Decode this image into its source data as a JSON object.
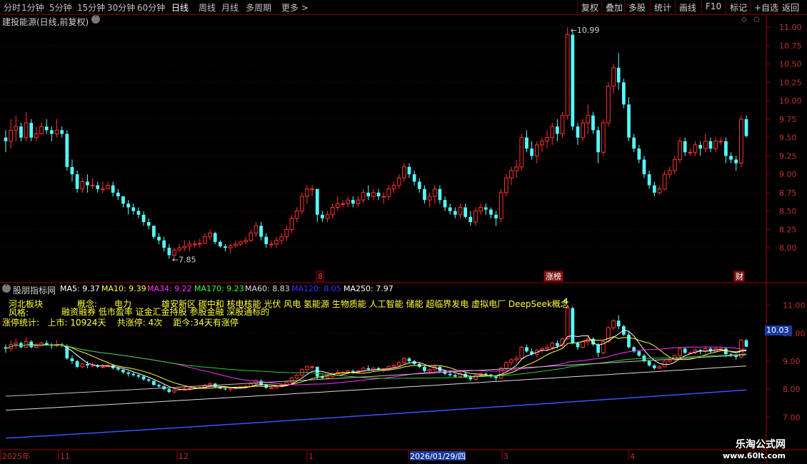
{
  "toolbar": {
    "timeframes": [
      "分时",
      "1分钟",
      "5分钟",
      "15分钟",
      "30分钟",
      "60分钟",
      "日线",
      "周线",
      "月线",
      "多周期",
      "更多 >"
    ],
    "active_timeframe": "日线",
    "buttons": [
      "复权",
      "叠加",
      "多股",
      "统计",
      "画线",
      "F10",
      "标记",
      "+自选",
      "返回"
    ]
  },
  "main_panel": {
    "title": "建投能源(日线,前复权)",
    "high_label": "10.99",
    "low_label": "7.85",
    "event_markers": [
      "8",
      "涨榜",
      "财"
    ]
  },
  "indicator_panel": {
    "title": "股朋指标网",
    "ma_items": [
      {
        "label": "MA5: 9.37",
        "color": "#ffffff"
      },
      {
        "label": "MA10: 9.39",
        "color": "#ffff33"
      },
      {
        "label": "MA34: 9.22",
        "color": "#ff33ff"
      },
      {
        "label": "MA170: 9.23",
        "color": "#33ff33"
      },
      {
        "label": "MA60: 8.83",
        "color": "#dddddd"
      },
      {
        "label": "MA120: 8.05",
        "color": "#3333ff"
      },
      {
        "label": "MA250: 7.97",
        "color": "#ffffff"
      }
    ],
    "sector_label": "河北板块",
    "concept_label": "概念:",
    "concepts": "电力           雄安新区 碳中和 核电核能 光伏 风电 氢能源 生物质能 人工智能 储能 超临界发电 虚拟电厂 DeepSeek概念",
    "style_label": "风格:",
    "styles": "融资融券 低市盈率 证金汇金持股 参股金融 深股通标的",
    "limit_stats": "涨停统计:   上市: 10924天    共涨停: 4次    距今:34天有涨停",
    "current_value": "10.03",
    "top_mark": "4"
  },
  "x_axis": {
    "labels": [
      "2025年",
      "11",
      "12",
      "1",
      "2026/01/29/四",
      "3",
      "4"
    ]
  },
  "watermark": {
    "name": "乐淘公式网",
    "url": "www.60lt.com"
  },
  "chart_data": {
    "type": "candlestick",
    "title": "建投能源(日线,前复权)",
    "main_y_ticks": [
      11.0,
      10.75,
      10.5,
      10.25,
      10.0,
      9.75,
      9.5,
      9.25,
      9.0,
      8.75,
      8.5,
      8.25,
      8.0
    ],
    "main_ylim": [
      7.7,
      11.08
    ],
    "sub_y_ticks": [
      11.0,
      10.0,
      9.0,
      8.0,
      7.0
    ],
    "sub_ylim": [
      6.6,
      11.4
    ],
    "candles": [
      [
        9.5,
        9.6,
        9.3,
        9.45
      ],
      [
        9.45,
        9.75,
        9.35,
        9.6
      ],
      [
        9.6,
        9.8,
        9.45,
        9.65
      ],
      [
        9.65,
        9.7,
        9.45,
        9.5
      ],
      [
        9.5,
        9.85,
        9.45,
        9.7
      ],
      [
        9.7,
        9.75,
        9.45,
        9.5
      ],
      [
        9.5,
        9.65,
        9.45,
        9.55
      ],
      [
        9.55,
        9.7,
        9.55,
        9.65
      ],
      [
        9.65,
        9.75,
        9.55,
        9.6
      ],
      [
        9.6,
        9.65,
        9.45,
        9.55
      ],
      [
        9.55,
        9.75,
        9.5,
        9.6
      ],
      [
        9.6,
        9.65,
        9.5,
        9.55
      ],
      [
        9.55,
        9.6,
        9.05,
        9.1
      ],
      [
        9.1,
        9.2,
        8.9,
        9.0
      ],
      [
        9.0,
        9.05,
        8.75,
        8.8
      ],
      [
        8.8,
        8.95,
        8.75,
        8.9
      ],
      [
        8.9,
        9.0,
        8.75,
        8.85
      ],
      [
        8.85,
        8.95,
        8.8,
        8.85
      ],
      [
        8.85,
        8.9,
        8.75,
        8.8
      ],
      [
        8.8,
        8.9,
        8.75,
        8.8
      ],
      [
        8.8,
        8.9,
        8.8,
        8.85
      ],
      [
        8.85,
        8.9,
        8.7,
        8.75
      ],
      [
        8.75,
        8.8,
        8.65,
        8.7
      ],
      [
        8.7,
        8.7,
        8.55,
        8.6
      ],
      [
        8.6,
        8.65,
        8.45,
        8.55
      ],
      [
        8.55,
        8.6,
        8.45,
        8.5
      ],
      [
        8.5,
        8.55,
        8.4,
        8.45
      ],
      [
        8.45,
        8.5,
        8.3,
        8.35
      ],
      [
        8.35,
        8.4,
        8.25,
        8.3
      ],
      [
        8.3,
        8.3,
        8.12,
        8.15
      ],
      [
        8.15,
        8.2,
        8.05,
        8.1
      ],
      [
        8.1,
        8.15,
        7.95,
        8.0
      ],
      [
        8.0,
        8.05,
        7.85,
        7.9
      ],
      [
        7.9,
        8.0,
        7.85,
        7.97
      ],
      [
        7.97,
        8.05,
        7.95,
        8.0
      ],
      [
        8.0,
        8.1,
        7.95,
        8.02
      ],
      [
        8.02,
        8.1,
        7.95,
        8.05
      ],
      [
        8.05,
        8.1,
        8.0,
        8.05
      ],
      [
        8.05,
        8.12,
        8.0,
        8.06
      ],
      [
        8.06,
        8.2,
        8.05,
        8.15
      ],
      [
        8.15,
        8.25,
        8.1,
        8.2
      ],
      [
        8.2,
        8.22,
        8.05,
        8.08
      ],
      [
        8.08,
        8.1,
        8.0,
        8.02
      ],
      [
        8.02,
        8.05,
        7.95,
        8.0
      ],
      [
        8.0,
        8.05,
        7.92,
        8.03
      ],
      [
        8.03,
        8.1,
        8.0,
        8.05
      ],
      [
        8.05,
        8.1,
        8.02,
        8.08
      ],
      [
        8.08,
        8.15,
        8.05,
        8.1
      ],
      [
        8.1,
        8.25,
        8.08,
        8.2
      ],
      [
        8.2,
        8.35,
        8.15,
        8.3
      ],
      [
        8.3,
        8.35,
        8.1,
        8.15
      ],
      [
        8.15,
        8.2,
        8.0,
        8.05
      ],
      [
        8.05,
        8.1,
        8.0,
        8.05
      ],
      [
        8.05,
        8.15,
        8.0,
        8.1
      ],
      [
        8.1,
        8.2,
        8.05,
        8.15
      ],
      [
        8.15,
        8.3,
        8.1,
        8.25
      ],
      [
        8.25,
        8.45,
        8.2,
        8.4
      ],
      [
        8.4,
        8.55,
        8.35,
        8.5
      ],
      [
        8.5,
        8.75,
        8.45,
        8.7
      ],
      [
        8.7,
        8.85,
        8.6,
        8.8
      ],
      [
        8.8,
        8.85,
        8.7,
        8.8
      ],
      [
        8.8,
        8.8,
        8.35,
        8.45
      ],
      [
        8.45,
        8.5,
        8.35,
        8.4
      ],
      [
        8.4,
        8.5,
        8.35,
        8.45
      ],
      [
        8.45,
        8.6,
        8.4,
        8.55
      ],
      [
        8.55,
        8.7,
        8.5,
        8.6
      ],
      [
        8.6,
        8.65,
        8.55,
        8.6
      ],
      [
        8.6,
        8.7,
        8.55,
        8.65
      ],
      [
        8.65,
        8.7,
        8.55,
        8.6
      ],
      [
        8.6,
        8.7,
        8.55,
        8.65
      ],
      [
        8.65,
        8.8,
        8.6,
        8.75
      ],
      [
        8.75,
        8.85,
        8.65,
        8.7
      ],
      [
        8.7,
        8.8,
        8.65,
        8.75
      ],
      [
        8.75,
        8.8,
        8.65,
        8.7
      ],
      [
        8.7,
        8.75,
        8.6,
        8.7
      ],
      [
        8.7,
        8.85,
        8.65,
        8.8
      ],
      [
        8.8,
        8.9,
        8.75,
        8.85
      ],
      [
        8.85,
        9.0,
        8.8,
        8.95
      ],
      [
        8.95,
        9.15,
        8.9,
        9.1
      ],
      [
        9.1,
        9.15,
        8.95,
        9.0
      ],
      [
        9.0,
        9.05,
        8.85,
        8.9
      ],
      [
        8.9,
        8.95,
        8.75,
        8.8
      ],
      [
        8.8,
        8.85,
        8.6,
        8.65
      ],
      [
        8.65,
        8.75,
        8.55,
        8.7
      ],
      [
        8.7,
        8.85,
        8.6,
        8.8
      ],
      [
        8.8,
        8.85,
        8.6,
        8.65
      ],
      [
        8.65,
        8.7,
        8.5,
        8.55
      ],
      [
        8.55,
        8.6,
        8.45,
        8.5
      ],
      [
        8.5,
        8.55,
        8.4,
        8.45
      ],
      [
        8.45,
        8.6,
        8.4,
        8.55
      ],
      [
        8.55,
        8.6,
        8.4,
        8.42
      ],
      [
        8.42,
        8.5,
        8.3,
        8.35
      ],
      [
        8.35,
        8.55,
        8.3,
        8.5
      ],
      [
        8.5,
        8.6,
        8.45,
        8.55
      ],
      [
        8.55,
        8.6,
        8.45,
        8.52
      ],
      [
        8.52,
        8.55,
        8.4,
        8.45
      ],
      [
        8.45,
        8.5,
        8.3,
        8.4
      ],
      [
        8.4,
        8.8,
        8.35,
        8.75
      ],
      [
        8.75,
        9.0,
        8.7,
        8.95
      ],
      [
        8.95,
        9.1,
        8.85,
        9.05
      ],
      [
        9.05,
        9.2,
        8.95,
        9.1
      ],
      [
        9.1,
        9.55,
        9.05,
        9.5
      ],
      [
        9.5,
        9.6,
        9.3,
        9.35
      ],
      [
        9.35,
        9.45,
        9.2,
        9.25
      ],
      [
        9.25,
        9.45,
        9.15,
        9.4
      ],
      [
        9.4,
        9.5,
        9.3,
        9.45
      ],
      [
        9.45,
        9.6,
        9.35,
        9.5
      ],
      [
        9.5,
        9.7,
        9.4,
        9.65
      ],
      [
        9.65,
        9.75,
        9.45,
        9.55
      ],
      [
        9.55,
        9.85,
        9.5,
        9.8
      ],
      [
        9.8,
        11.0,
        9.75,
        10.9
      ],
      [
        10.9,
        10.95,
        9.6,
        9.65
      ],
      [
        9.65,
        9.7,
        9.4,
        9.5
      ],
      [
        9.5,
        9.75,
        9.45,
        9.7
      ],
      [
        9.7,
        9.95,
        9.55,
        9.8
      ],
      [
        9.8,
        9.85,
        9.55,
        9.6
      ],
      [
        9.6,
        9.65,
        9.15,
        9.3
      ],
      [
        9.3,
        9.75,
        9.25,
        9.7
      ],
      [
        9.7,
        10.25,
        9.65,
        10.2
      ],
      [
        10.2,
        10.5,
        10.1,
        10.45
      ],
      [
        10.45,
        10.65,
        10.15,
        10.25
      ],
      [
        10.25,
        10.3,
        9.9,
        9.95
      ],
      [
        9.95,
        10.05,
        9.45,
        9.5
      ],
      [
        9.5,
        9.55,
        9.3,
        9.35
      ],
      [
        9.35,
        9.4,
        9.15,
        9.2
      ],
      [
        9.2,
        9.25,
        8.95,
        9.0
      ],
      [
        9.0,
        9.05,
        8.8,
        8.85
      ],
      [
        8.85,
        8.9,
        8.7,
        8.75
      ],
      [
        8.75,
        8.85,
        8.72,
        8.8
      ],
      [
        8.8,
        9.05,
        8.78,
        9.0
      ],
      [
        9.0,
        9.1,
        8.95,
        9.05
      ],
      [
        9.05,
        9.25,
        9.0,
        9.2
      ],
      [
        9.2,
        9.5,
        9.15,
        9.45
      ],
      [
        9.45,
        9.5,
        9.25,
        9.3
      ],
      [
        9.3,
        9.35,
        9.25,
        9.3
      ],
      [
        9.3,
        9.45,
        9.25,
        9.4
      ],
      [
        9.4,
        9.45,
        9.25,
        9.35
      ],
      [
        9.35,
        9.55,
        9.3,
        9.45
      ],
      [
        9.45,
        9.5,
        9.3,
        9.35
      ],
      [
        9.35,
        9.5,
        9.3,
        9.45
      ],
      [
        9.45,
        9.5,
        9.4,
        9.45
      ],
      [
        9.45,
        9.5,
        9.15,
        9.25
      ],
      [
        9.25,
        9.3,
        9.15,
        9.2
      ],
      [
        9.2,
        9.25,
        9.05,
        9.15
      ],
      [
        9.15,
        9.8,
        9.1,
        9.75
      ],
      [
        9.75,
        9.8,
        9.5,
        9.52
      ]
    ]
  }
}
